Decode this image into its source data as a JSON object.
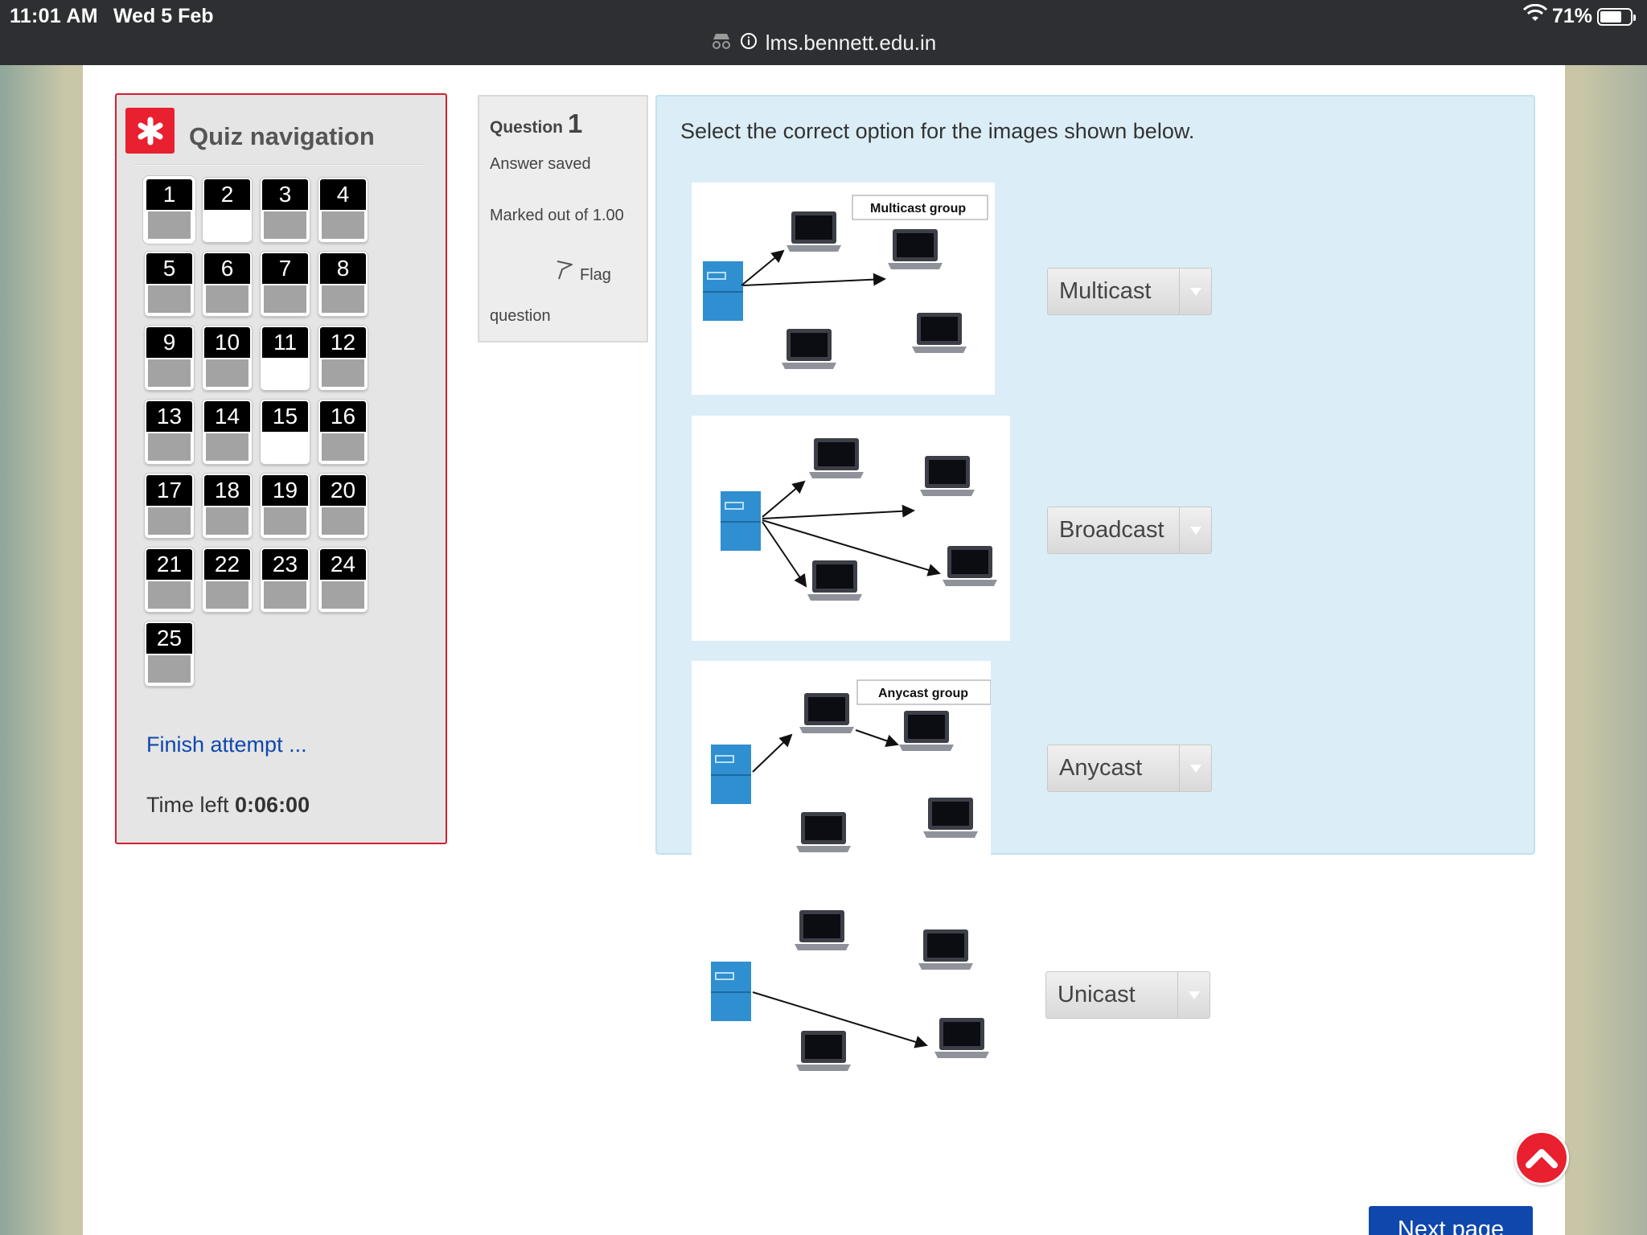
{
  "status_bar": {
    "time": "11:01 AM",
    "date": "Wed 5 Feb",
    "battery_percent": "71%",
    "battery_level": 0.71
  },
  "url_bar": {
    "url": "lms.bennett.edu.in",
    "icons": [
      "incognito-icon",
      "info-icon"
    ]
  },
  "quiz_nav": {
    "title": "Quiz navigation",
    "buttons": [
      {
        "label": "1",
        "state": "answered",
        "current": true
      },
      {
        "label": "2",
        "state": "open"
      },
      {
        "label": "3",
        "state": "answered"
      },
      {
        "label": "4",
        "state": "answered"
      },
      {
        "label": "5",
        "state": "answered"
      },
      {
        "label": "6",
        "state": "answered"
      },
      {
        "label": "7",
        "state": "answered"
      },
      {
        "label": "8",
        "state": "answered"
      },
      {
        "label": "9",
        "state": "answered"
      },
      {
        "label": "10",
        "state": "answered"
      },
      {
        "label": "11",
        "state": "open"
      },
      {
        "label": "12",
        "state": "answered"
      },
      {
        "label": "13",
        "state": "answered"
      },
      {
        "label": "14",
        "state": "answered"
      },
      {
        "label": "15",
        "state": "open"
      },
      {
        "label": "16",
        "state": "answered"
      },
      {
        "label": "17",
        "state": "answered"
      },
      {
        "label": "18",
        "state": "answered"
      },
      {
        "label": "19",
        "state": "answered"
      },
      {
        "label": "20",
        "state": "answered"
      },
      {
        "label": "21",
        "state": "answered"
      },
      {
        "label": "22",
        "state": "answered"
      },
      {
        "label": "23",
        "state": "answered"
      },
      {
        "label": "24",
        "state": "answered"
      },
      {
        "label": "25",
        "state": "answered"
      }
    ],
    "finish_link": "Finish attempt ...",
    "time_left_label": "Time left",
    "time_left_value": "0:06:00"
  },
  "question_info": {
    "label": "Question",
    "number": "1",
    "state": "Answer saved",
    "grade": "Marked out of 1.00",
    "flag_label": "Flag question"
  },
  "question": {
    "text": "Select the correct option for the images shown below.",
    "items": [
      {
        "image_caption": "Multicast group",
        "selected": "Multicast"
      },
      {
        "image_caption": "",
        "selected": "Broadcast"
      },
      {
        "image_caption": "Anycast group",
        "selected": "Anycast"
      },
      {
        "image_caption": "",
        "selected": "Unicast"
      }
    ]
  },
  "next_button": "Next page",
  "colors": {
    "accent_red": "#e8202f",
    "link_blue": "#0f47ad",
    "question_bg": "#dbeef7"
  }
}
